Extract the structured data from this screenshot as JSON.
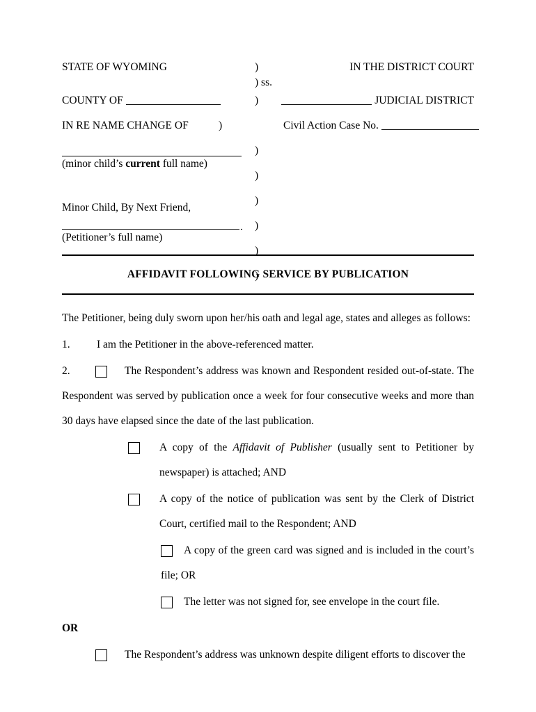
{
  "caption": {
    "state_line": "STATE OF WYOMING",
    "paren": ")",
    "ss": ") ss.",
    "court_line": "IN THE DISTRICT COURT",
    "county_label": "COUNTY OF",
    "judicial_district": "JUDICIAL DISTRICT",
    "in_re": "IN RE NAME CHANGE OF",
    "case_label": "Civil Action Case No.",
    "minor_child_label_1": "(minor child’s ",
    "minor_child_label_bold": "current",
    "minor_child_label_2": " full name)",
    "next_friend": "Minor Child, By Next Friend,",
    "petitioner_label": "(Petitioner’s full name)",
    "period": "."
  },
  "document": {
    "title": "AFFIDAVIT FOLLOWING SERVICE BY PUBLICATION",
    "intro": "The Petitioner, being duly sworn upon her/his oath and legal age, states and alleges as follows:",
    "item1_number": "1.",
    "item1_text": "I am the Petitioner in the above-referenced matter.",
    "item2_number": "2.",
    "item2_text": "The Respondent’s address was known and Respondent resided out-of-state.  The Respondent was served by publication once a week for four consecutive weeks and more than 30 days have elapsed since the date of the last publication.",
    "sub_a_pre": "A copy of the ",
    "sub_a_italic": "Affidavit of Publisher",
    "sub_a_post": " (usually sent to Petitioner by newspaper) is attached; AND",
    "sub_b": "A copy of the notice of publication was sent by the Clerk of District Court, certified mail to the Respondent; AND",
    "sub_c": "A copy of the green card was signed and is included in the court’s file; OR",
    "sub_d": "The letter was not signed for, see envelope in the court file.",
    "or_label": "OR",
    "item3_text": "The Respondent’s address was unknown despite diligent efforts to discover the"
  }
}
